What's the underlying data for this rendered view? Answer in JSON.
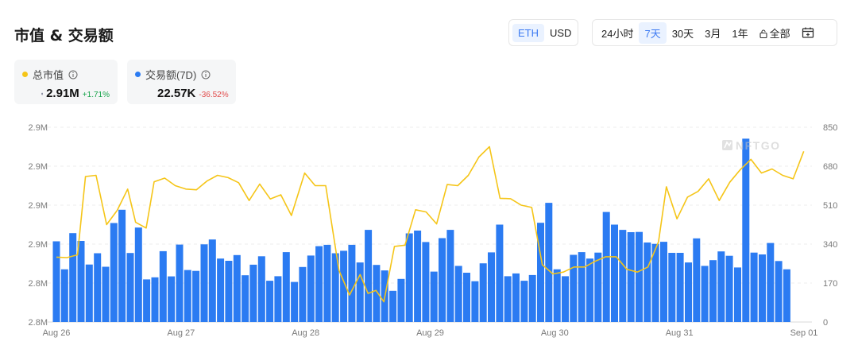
{
  "header": {
    "title": "市值 & 交易额"
  },
  "currency_toggle": {
    "options": [
      "ETH",
      "USD"
    ],
    "selected": "ETH"
  },
  "range_toggle": {
    "options": [
      "24小时",
      "7天",
      "30天",
      "3月",
      "1年",
      "全部"
    ],
    "selected": "7天"
  },
  "metrics": {
    "market_cap": {
      "label": "总市值",
      "value": "2.91M",
      "change": "+1.71%",
      "color": "#f5c518",
      "change_color": "#16a34a"
    },
    "volume": {
      "label": "交易额(7D)",
      "value": "22.57K",
      "change": "-36.52%",
      "color": "#2b7bf2",
      "change_color": "#e24c4c"
    }
  },
  "watermark": "NFTGO",
  "chart_data": {
    "type": "bar+line",
    "x_tick_labels": [
      "Aug 26",
      "Aug 27",
      "Aug 28",
      "Aug 29",
      "Aug 30",
      "Aug 31",
      "Sep 01"
    ],
    "left_axis": {
      "ticks": [
        "2.8M",
        "2.8M",
        "2.9M",
        "2.9M",
        "2.9M",
        "2.9M"
      ],
      "ylim": [
        2.8,
        2.9
      ]
    },
    "right_axis": {
      "ticks": [
        "0",
        "170",
        "340",
        "510",
        "680",
        "850"
      ],
      "ylim": [
        0,
        850
      ]
    },
    "grid": true,
    "series": [
      {
        "name": "交易额(7D)",
        "type": "bar",
        "axis": "right",
        "color": "#2b7bf2",
        "values": [
          352,
          230,
          388,
          354,
          251,
          300,
          241,
          432,
          490,
          301,
          412,
          186,
          195,
          309,
          199,
          338,
          227,
          223,
          339,
          360,
          277,
          267,
          292,
          204,
          250,
          287,
          180,
          200,
          305,
          175,
          240,
          290,
          331,
          337,
          300,
          311,
          337,
          260,
          402,
          249,
          225,
          136,
          188,
          387,
          399,
          349,
          220,
          366,
          402,
          245,
          215,
          178,
          256,
          304,
          425,
          200,
          212,
          180,
          205,
          433,
          520,
          230,
          200,
          293,
          305,
          277,
          303,
          480,
          425,
          402,
          392,
          393,
          347,
          341,
          350,
          302,
          302,
          260,
          365,
          245,
          270,
          308,
          289,
          238,
          800,
          303,
          295,
          345,
          266,
          230
        ],
        "first_x": 0,
        "step": 0.0777
      },
      {
        "name": "总市值",
        "type": "line",
        "axis": "right",
        "color": "#f5c518",
        "points": [
          [
            0.0,
            283
          ],
          [
            0.2,
            281
          ],
          [
            0.4,
            293
          ],
          [
            0.55,
            635
          ],
          [
            0.75,
            640
          ],
          [
            0.95,
            425
          ],
          [
            1.15,
            487
          ],
          [
            1.35,
            580
          ],
          [
            1.5,
            435
          ],
          [
            1.7,
            410
          ],
          [
            1.85,
            612
          ],
          [
            2.05,
            628
          ],
          [
            2.25,
            595
          ],
          [
            2.45,
            580
          ],
          [
            2.65,
            577
          ],
          [
            2.85,
            615
          ],
          [
            3.05,
            640
          ],
          [
            3.25,
            630
          ],
          [
            3.45,
            608
          ],
          [
            3.65,
            530
          ],
          [
            3.85,
            602
          ],
          [
            4.05,
            537
          ],
          [
            4.25,
            555
          ],
          [
            4.45,
            465
          ],
          [
            4.7,
            650
          ],
          [
            4.9,
            595
          ],
          [
            5.1,
            595
          ],
          [
            5.35,
            225
          ],
          [
            5.55,
            118
          ],
          [
            5.75,
            207
          ],
          [
            5.9,
            125
          ],
          [
            6.05,
            138
          ],
          [
            6.2,
            88
          ],
          [
            6.4,
            330
          ],
          [
            6.6,
            335
          ],
          [
            6.8,
            490
          ],
          [
            7.0,
            480
          ],
          [
            7.2,
            428
          ],
          [
            7.4,
            600
          ],
          [
            7.6,
            595
          ],
          [
            7.8,
            640
          ],
          [
            8.0,
            720
          ],
          [
            8.2,
            765
          ],
          [
            8.4,
            540
          ],
          [
            8.6,
            538
          ],
          [
            8.8,
            510
          ],
          [
            9.0,
            500
          ],
          [
            9.2,
            250
          ],
          [
            9.4,
            210
          ],
          [
            9.6,
            218
          ],
          [
            9.8,
            240
          ],
          [
            10.0,
            240
          ],
          [
            10.2,
            265
          ],
          [
            10.4,
            285
          ],
          [
            10.6,
            285
          ],
          [
            10.8,
            230
          ],
          [
            11.0,
            218
          ],
          [
            11.2,
            240
          ],
          [
            11.4,
            350
          ],
          [
            11.55,
            590
          ],
          [
            11.75,
            450
          ],
          [
            11.95,
            545
          ],
          [
            12.15,
            570
          ],
          [
            12.35,
            625
          ],
          [
            12.55,
            530
          ],
          [
            12.75,
            610
          ],
          [
            12.95,
            665
          ],
          [
            13.15,
            710
          ],
          [
            13.35,
            650
          ],
          [
            13.55,
            668
          ],
          [
            13.75,
            640
          ],
          [
            13.95,
            625
          ],
          [
            14.15,
            745
          ]
        ],
        "x_max": 14.2
      }
    ]
  }
}
